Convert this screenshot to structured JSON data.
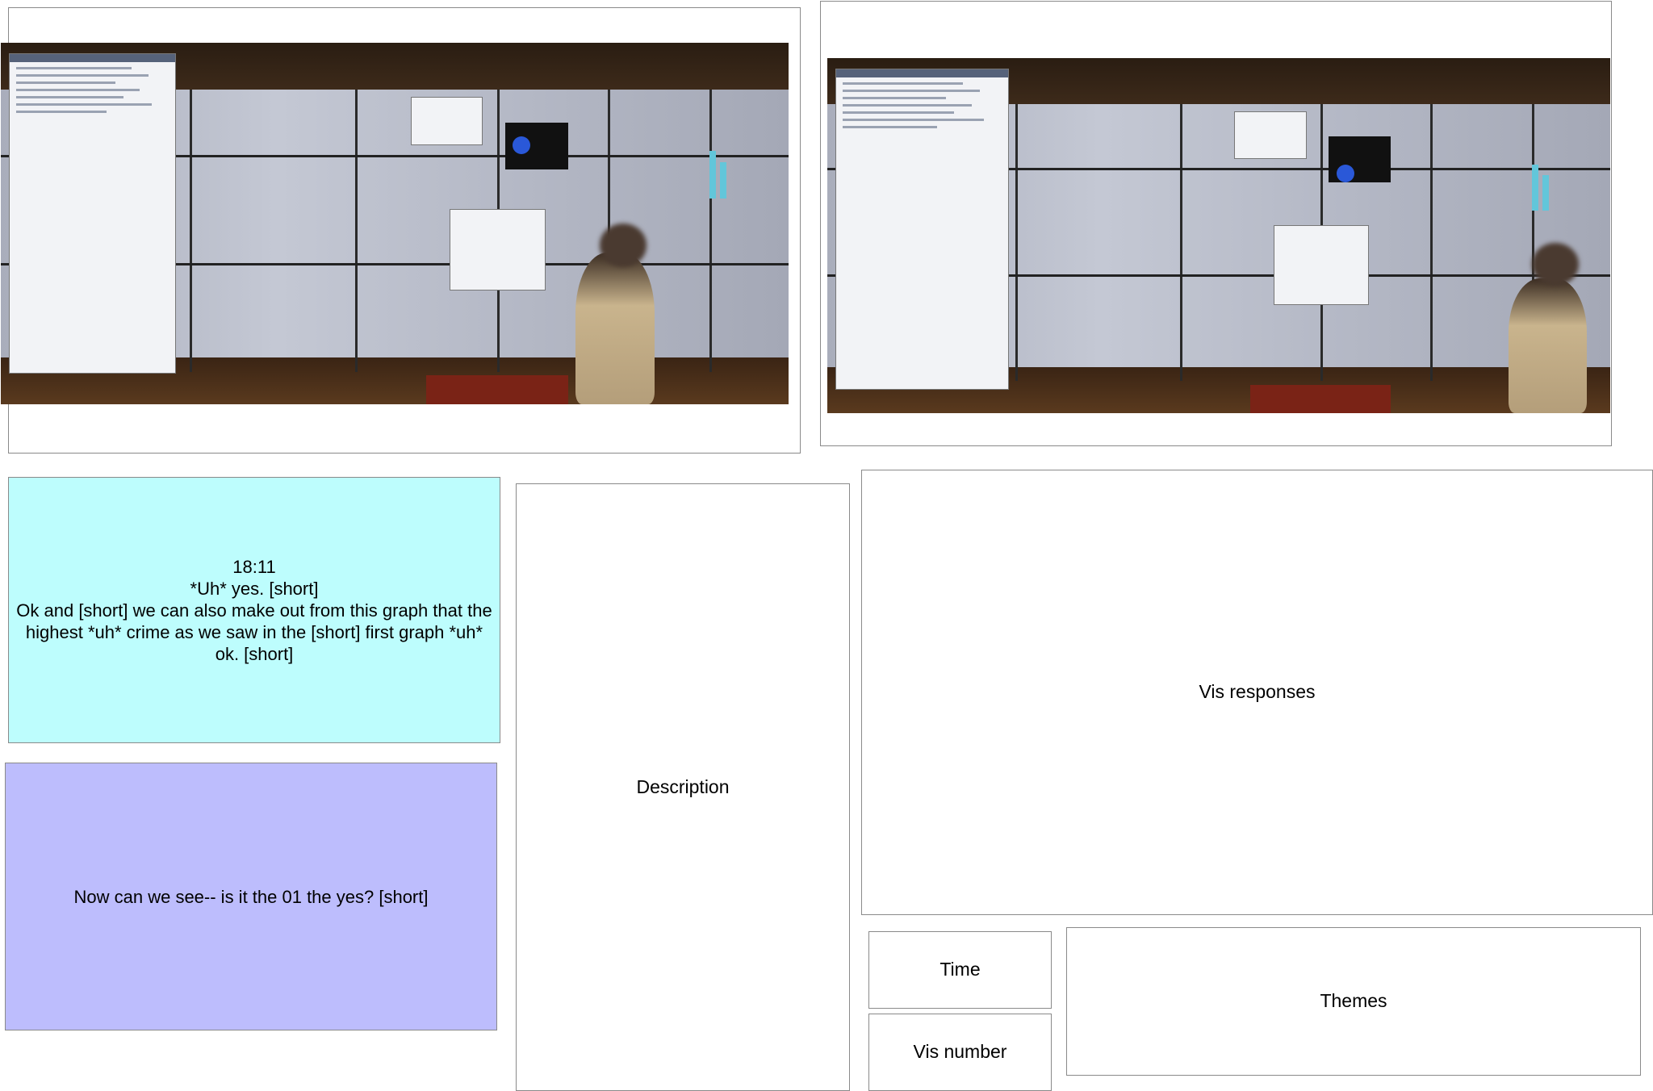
{
  "transcript_current": {
    "time": "18:11",
    "lines": [
      "*Uh* yes. [short]",
      "Ok and [short] we can also make out from this graph that the highest *uh* crime as we saw in the [short] first graph *uh* ok. [short]"
    ]
  },
  "transcript_next": {
    "text": "Now can we see-- is it the 01 the yes? [short]"
  },
  "fields": {
    "description": "Description",
    "vis_responses": "Vis responses",
    "time": "Time",
    "vis_number": "Vis number",
    "themes": "Themes"
  },
  "colors": {
    "current_box": "#bdfdfd",
    "next_box": "#bdbdfd"
  },
  "icons": [
    "video-frame-left",
    "video-frame-right"
  ]
}
